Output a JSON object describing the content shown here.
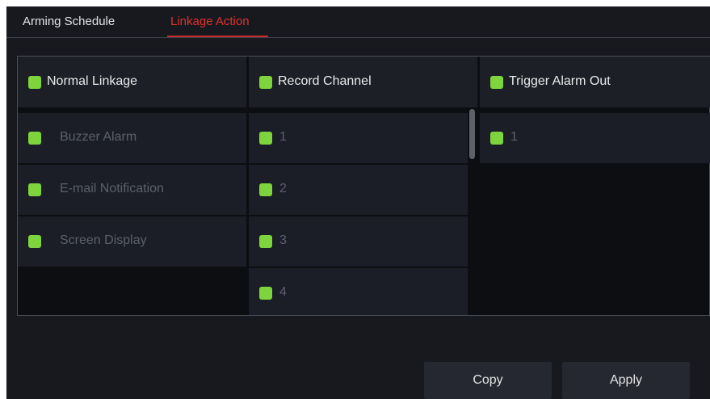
{
  "tabs": {
    "arming_schedule": "Arming Schedule",
    "linkage_action": "Linkage Action",
    "active": "Linkage Action"
  },
  "columns": {
    "normal_linkage": {
      "title": "Normal Linkage",
      "checked": true,
      "items": [
        {
          "label": "Buzzer Alarm",
          "checked": true
        },
        {
          "label": "E-mail Notification",
          "checked": true
        },
        {
          "label": "Screen Display",
          "checked": true
        }
      ]
    },
    "record_channel": {
      "title": "Record Channel",
      "checked": true,
      "items": [
        {
          "label": "1",
          "checked": true
        },
        {
          "label": "2",
          "checked": true
        },
        {
          "label": "3",
          "checked": true
        },
        {
          "label": "4",
          "checked": true
        }
      ]
    },
    "trigger_alarm_out": {
      "title": "Trigger Alarm Out",
      "checked": true,
      "items": [
        {
          "label": "1",
          "checked": true
        }
      ]
    }
  },
  "buttons": {
    "copy": "Copy",
    "apply": "Apply"
  },
  "colors": {
    "accent_active_tab": "#e0322d",
    "checkbox": "#7ed43c",
    "background": "#17191f"
  }
}
